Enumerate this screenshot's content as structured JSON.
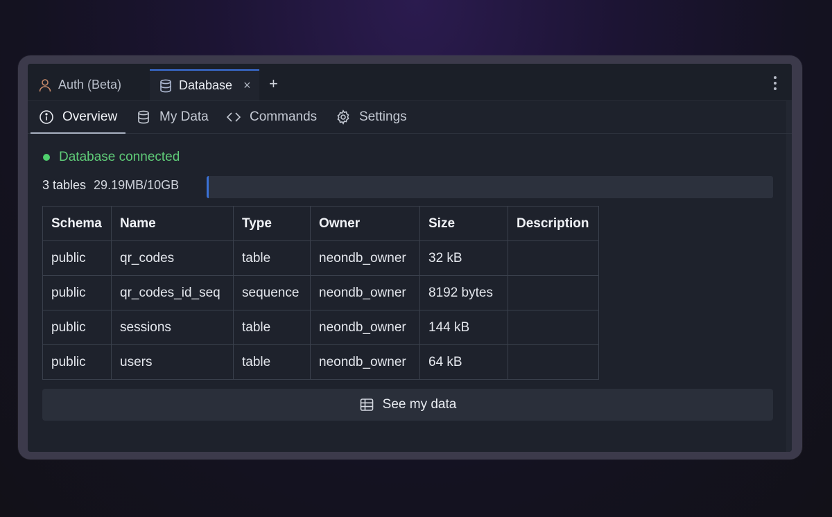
{
  "tabs": {
    "auth": {
      "label": "Auth (Beta)",
      "icon": "user-icon"
    },
    "database": {
      "label": "Database",
      "icon": "database-icon",
      "close": "×"
    },
    "add": "+"
  },
  "subnav": {
    "overview": "Overview",
    "mydata": "My Data",
    "commands": "Commands",
    "settings": "Settings"
  },
  "status": {
    "text": "Database connected",
    "color": "#4fd06d"
  },
  "usage": {
    "tables": "3 tables",
    "size": "29.19MB/10GB",
    "fraction": 0.003
  },
  "table": {
    "headers": [
      "Schema",
      "Name",
      "Type",
      "Owner",
      "Size",
      "Description"
    ],
    "rows": [
      [
        "public",
        "qr_codes",
        "table",
        "neondb_owner",
        "32 kB",
        ""
      ],
      [
        "public",
        "qr_codes_id_seq",
        "sequence",
        "neondb_owner",
        "8192 bytes",
        ""
      ],
      [
        "public",
        "sessions",
        "table",
        "neondb_owner",
        "144 kB",
        ""
      ],
      [
        "public",
        "users",
        "table",
        "neondb_owner",
        "64 kB",
        ""
      ]
    ]
  },
  "see_button": {
    "label": "See my data",
    "icon": "table-icon"
  },
  "colors": {
    "accent": "#3a71d6",
    "panel": "#1e222c"
  }
}
